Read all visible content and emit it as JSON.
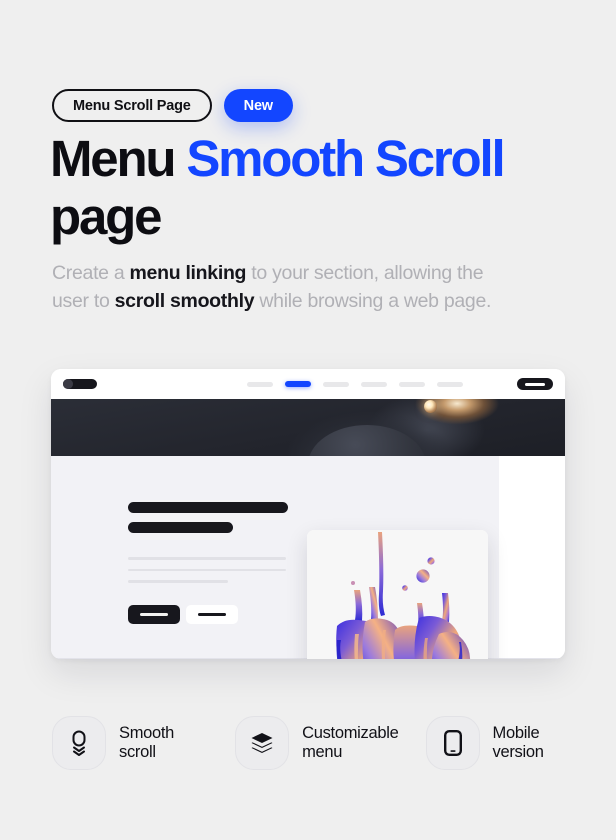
{
  "theme": {
    "background": "#efefef",
    "accent_blue": "#1346ff",
    "ink": "#0d0d12",
    "muted": "#b0b0b5"
  },
  "badges": {
    "outline_label": "Menu Scroll Page",
    "new_label": "New"
  },
  "headline": {
    "part1": "Menu ",
    "part2": "Smooth Scroll",
    "part3": " page"
  },
  "lede": {
    "seg1": "Create a ",
    "strong1": "menu linking",
    "seg2": " to your section, allowing the user to ",
    "strong2": "scroll smoothly",
    "seg3": " while browsing a web page."
  },
  "mockup": {
    "nav": {
      "logo": "site-logo-pill",
      "links": [
        {
          "state": "inactive"
        },
        {
          "state": "active"
        },
        {
          "state": "inactive"
        },
        {
          "state": "inactive"
        },
        {
          "state": "inactive"
        },
        {
          "state": "inactive"
        }
      ],
      "cta": "nav-cta-button"
    },
    "hero": {
      "image": "dark-abstract-3d-sphere"
    },
    "content": {
      "heading_bar_1": "heading-placeholder-long",
      "heading_bar_2": "heading-placeholder-short",
      "text_lines": [
        "line-full",
        "line-full",
        "line-short"
      ],
      "primary_button": "primary-cta-placeholder",
      "secondary_button": "secondary-cta-placeholder",
      "image_card": "liquid-splash-artwork"
    }
  },
  "features": [
    {
      "icon": "mouse-scroll-icon",
      "label": "Smooth\nscroll"
    },
    {
      "icon": "layers-stack-icon",
      "label": "Customizable\nmenu"
    },
    {
      "icon": "mobile-phone-icon",
      "label": "Mobile\nversion"
    }
  ]
}
